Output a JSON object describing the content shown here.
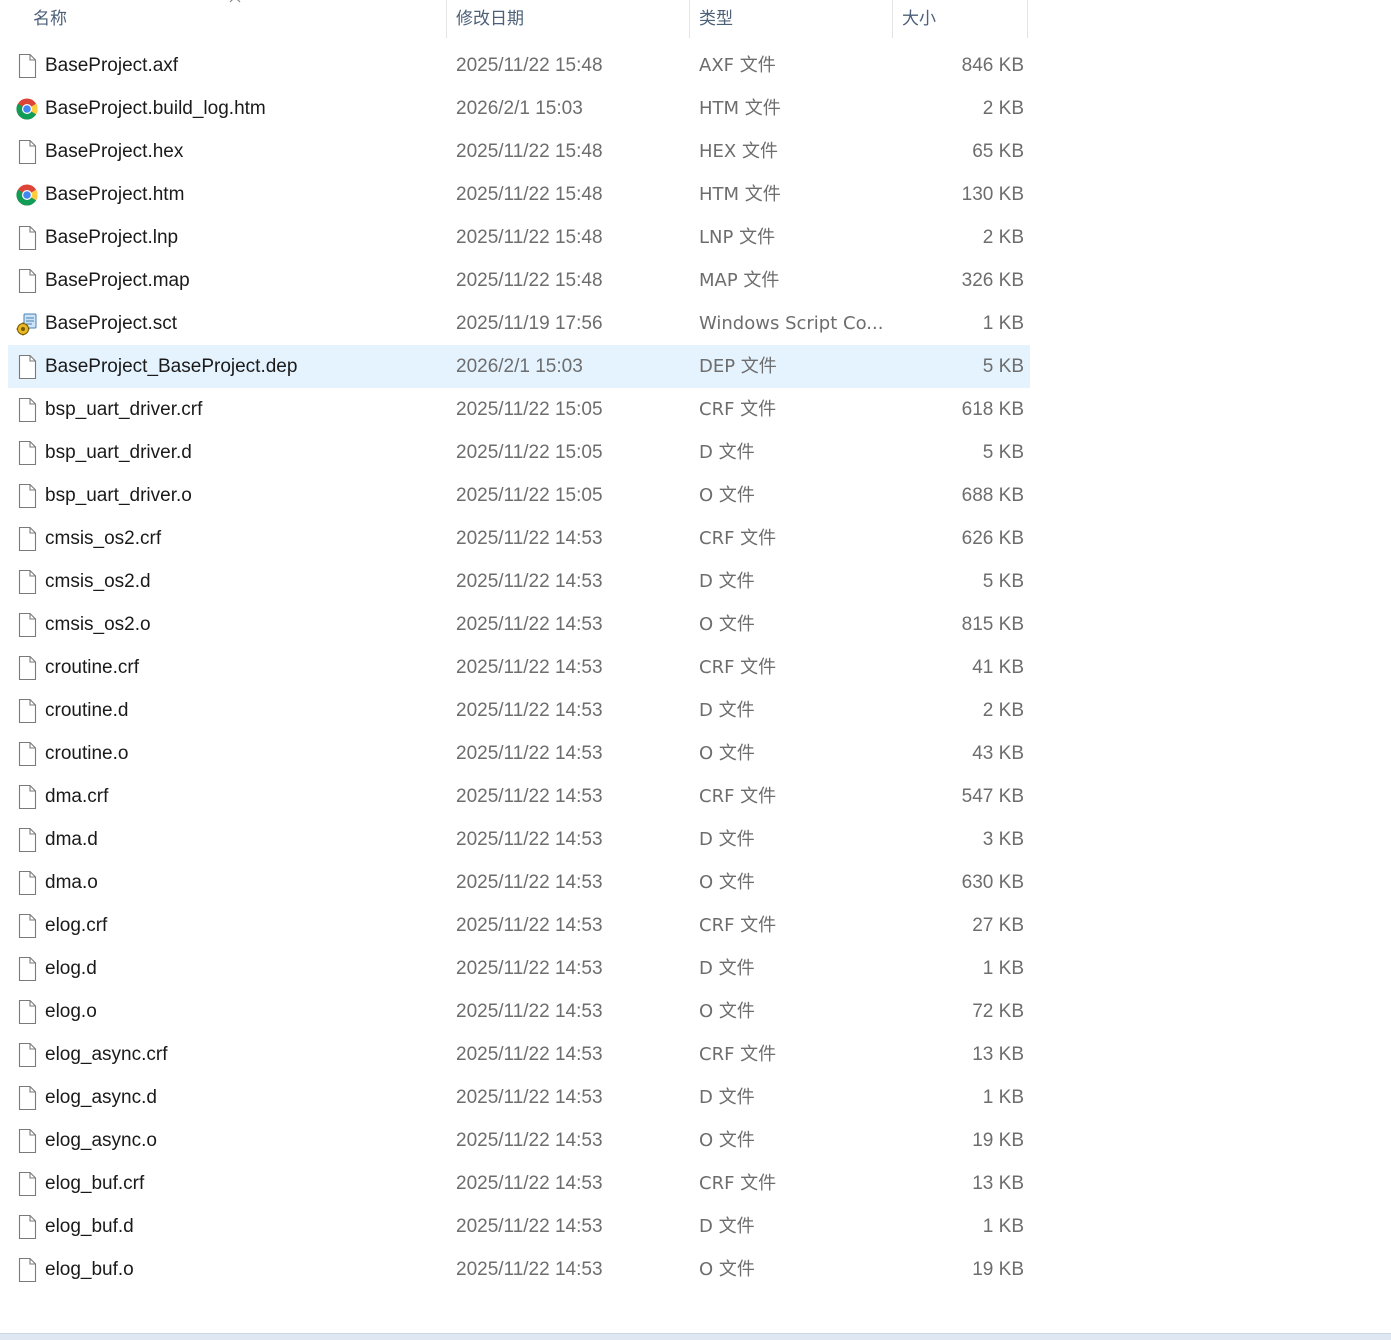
{
  "columns": {
    "name": "名称",
    "date": "修改日期",
    "type": "类型",
    "size": "大小"
  },
  "sort_indicator": "chevron-up-icon",
  "colors": {
    "selected_row": "#e5f3ff",
    "header_text": "#4c607a",
    "detail_text": "#6d6d6d"
  },
  "files": [
    {
      "name": "BaseProject.axf",
      "date": "2025/11/22 15:48",
      "type": "AXF 文件",
      "size": "846 KB",
      "icon": "file-icon"
    },
    {
      "name": "BaseProject.build_log.htm",
      "date": "2026/2/1 15:03",
      "type": "HTM 文件",
      "size": "2 KB",
      "icon": "chrome-icon"
    },
    {
      "name": "BaseProject.hex",
      "date": "2025/11/22 15:48",
      "type": "HEX 文件",
      "size": "65 KB",
      "icon": "file-icon"
    },
    {
      "name": "BaseProject.htm",
      "date": "2025/11/22 15:48",
      "type": "HTM 文件",
      "size": "130 KB",
      "icon": "chrome-icon"
    },
    {
      "name": "BaseProject.lnp",
      "date": "2025/11/22 15:48",
      "type": "LNP 文件",
      "size": "2 KB",
      "icon": "file-icon"
    },
    {
      "name": "BaseProject.map",
      "date": "2025/11/22 15:48",
      "type": "MAP 文件",
      "size": "326 KB",
      "icon": "file-icon"
    },
    {
      "name": "BaseProject.sct",
      "date": "2025/11/19 17:56",
      "type": "Windows Script Co...",
      "size": "1 KB",
      "icon": "script-icon"
    },
    {
      "name": "BaseProject_BaseProject.dep",
      "date": "2026/2/1 15:03",
      "type": "DEP 文件",
      "size": "5 KB",
      "icon": "file-icon",
      "selected": true
    },
    {
      "name": "bsp_uart_driver.crf",
      "date": "2025/11/22 15:05",
      "type": "CRF 文件",
      "size": "618 KB",
      "icon": "file-icon"
    },
    {
      "name": "bsp_uart_driver.d",
      "date": "2025/11/22 15:05",
      "type": "D 文件",
      "size": "5 KB",
      "icon": "file-icon"
    },
    {
      "name": "bsp_uart_driver.o",
      "date": "2025/11/22 15:05",
      "type": "O 文件",
      "size": "688 KB",
      "icon": "file-icon"
    },
    {
      "name": "cmsis_os2.crf",
      "date": "2025/11/22 14:53",
      "type": "CRF 文件",
      "size": "626 KB",
      "icon": "file-icon"
    },
    {
      "name": "cmsis_os2.d",
      "date": "2025/11/22 14:53",
      "type": "D 文件",
      "size": "5 KB",
      "icon": "file-icon"
    },
    {
      "name": "cmsis_os2.o",
      "date": "2025/11/22 14:53",
      "type": "O 文件",
      "size": "815 KB",
      "icon": "file-icon"
    },
    {
      "name": "croutine.crf",
      "date": "2025/11/22 14:53",
      "type": "CRF 文件",
      "size": "41 KB",
      "icon": "file-icon"
    },
    {
      "name": "croutine.d",
      "date": "2025/11/22 14:53",
      "type": "D 文件",
      "size": "2 KB",
      "icon": "file-icon"
    },
    {
      "name": "croutine.o",
      "date": "2025/11/22 14:53",
      "type": "O 文件",
      "size": "43 KB",
      "icon": "file-icon"
    },
    {
      "name": "dma.crf",
      "date": "2025/11/22 14:53",
      "type": "CRF 文件",
      "size": "547 KB",
      "icon": "file-icon"
    },
    {
      "name": "dma.d",
      "date": "2025/11/22 14:53",
      "type": "D 文件",
      "size": "3 KB",
      "icon": "file-icon"
    },
    {
      "name": "dma.o",
      "date": "2025/11/22 14:53",
      "type": "O 文件",
      "size": "630 KB",
      "icon": "file-icon"
    },
    {
      "name": "elog.crf",
      "date": "2025/11/22 14:53",
      "type": "CRF 文件",
      "size": "27 KB",
      "icon": "file-icon"
    },
    {
      "name": "elog.d",
      "date": "2025/11/22 14:53",
      "type": "D 文件",
      "size": "1 KB",
      "icon": "file-icon"
    },
    {
      "name": "elog.o",
      "date": "2025/11/22 14:53",
      "type": "O 文件",
      "size": "72 KB",
      "icon": "file-icon"
    },
    {
      "name": "elog_async.crf",
      "date": "2025/11/22 14:53",
      "type": "CRF 文件",
      "size": "13 KB",
      "icon": "file-icon"
    },
    {
      "name": "elog_async.d",
      "date": "2025/11/22 14:53",
      "type": "D 文件",
      "size": "1 KB",
      "icon": "file-icon"
    },
    {
      "name": "elog_async.o",
      "date": "2025/11/22 14:53",
      "type": "O 文件",
      "size": "19 KB",
      "icon": "file-icon"
    },
    {
      "name": "elog_buf.crf",
      "date": "2025/11/22 14:53",
      "type": "CRF 文件",
      "size": "13 KB",
      "icon": "file-icon"
    },
    {
      "name": "elog_buf.d",
      "date": "2025/11/22 14:53",
      "type": "D 文件",
      "size": "1 KB",
      "icon": "file-icon"
    },
    {
      "name": "elog_buf.o",
      "date": "2025/11/22 14:53",
      "type": "O 文件",
      "size": "19 KB",
      "icon": "file-icon"
    }
  ]
}
